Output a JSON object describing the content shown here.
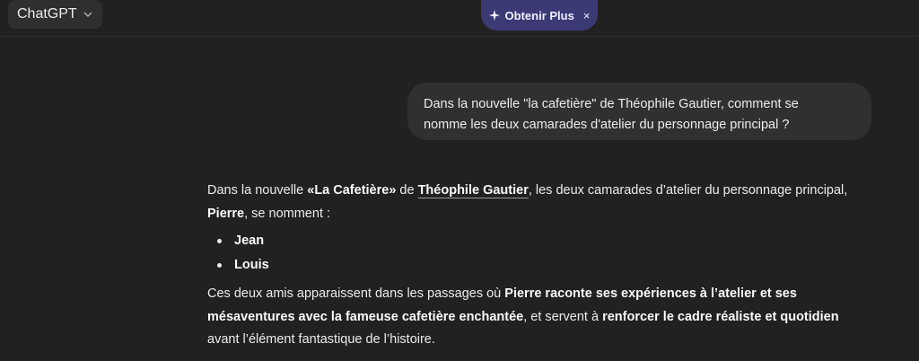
{
  "header": {
    "model_label": "ChatGPT",
    "promo_label": "Obtenir Plus",
    "promo_close": "×"
  },
  "user_message": {
    "line1": "Dans la nouvelle \"la cafetière\" de Théophile Gautier, comment se",
    "line2": "nomme les deux camarades d'atelier du personnage principal ?"
  },
  "assistant": {
    "p1": {
      "t1": "Dans la nouvelle ",
      "b1": "«La Cafetière»",
      "t2": " de ",
      "b2": "Théophile Gautier",
      "t3": ", les deux camarades d’atelier du personnage principal, ",
      "b3": "Pierre",
      "t4": ", se nomment :"
    },
    "list": [
      "Jean",
      "Louis"
    ],
    "p2": {
      "t1": "Ces deux amis apparaissent dans les passages où ",
      "b1": "Pierre raconte ses expériences à l’atelier et ses mésaventures avec la fameuse cafetière enchantée",
      "t2": ", et servent à ",
      "b2": "renforcer le cadre réaliste et quotidien",
      "t3": " avant l’élément fantastique de l’histoire."
    }
  },
  "icons": {
    "model_dropdown": "chevron-down-icon",
    "promo": "sparkle-icon"
  }
}
